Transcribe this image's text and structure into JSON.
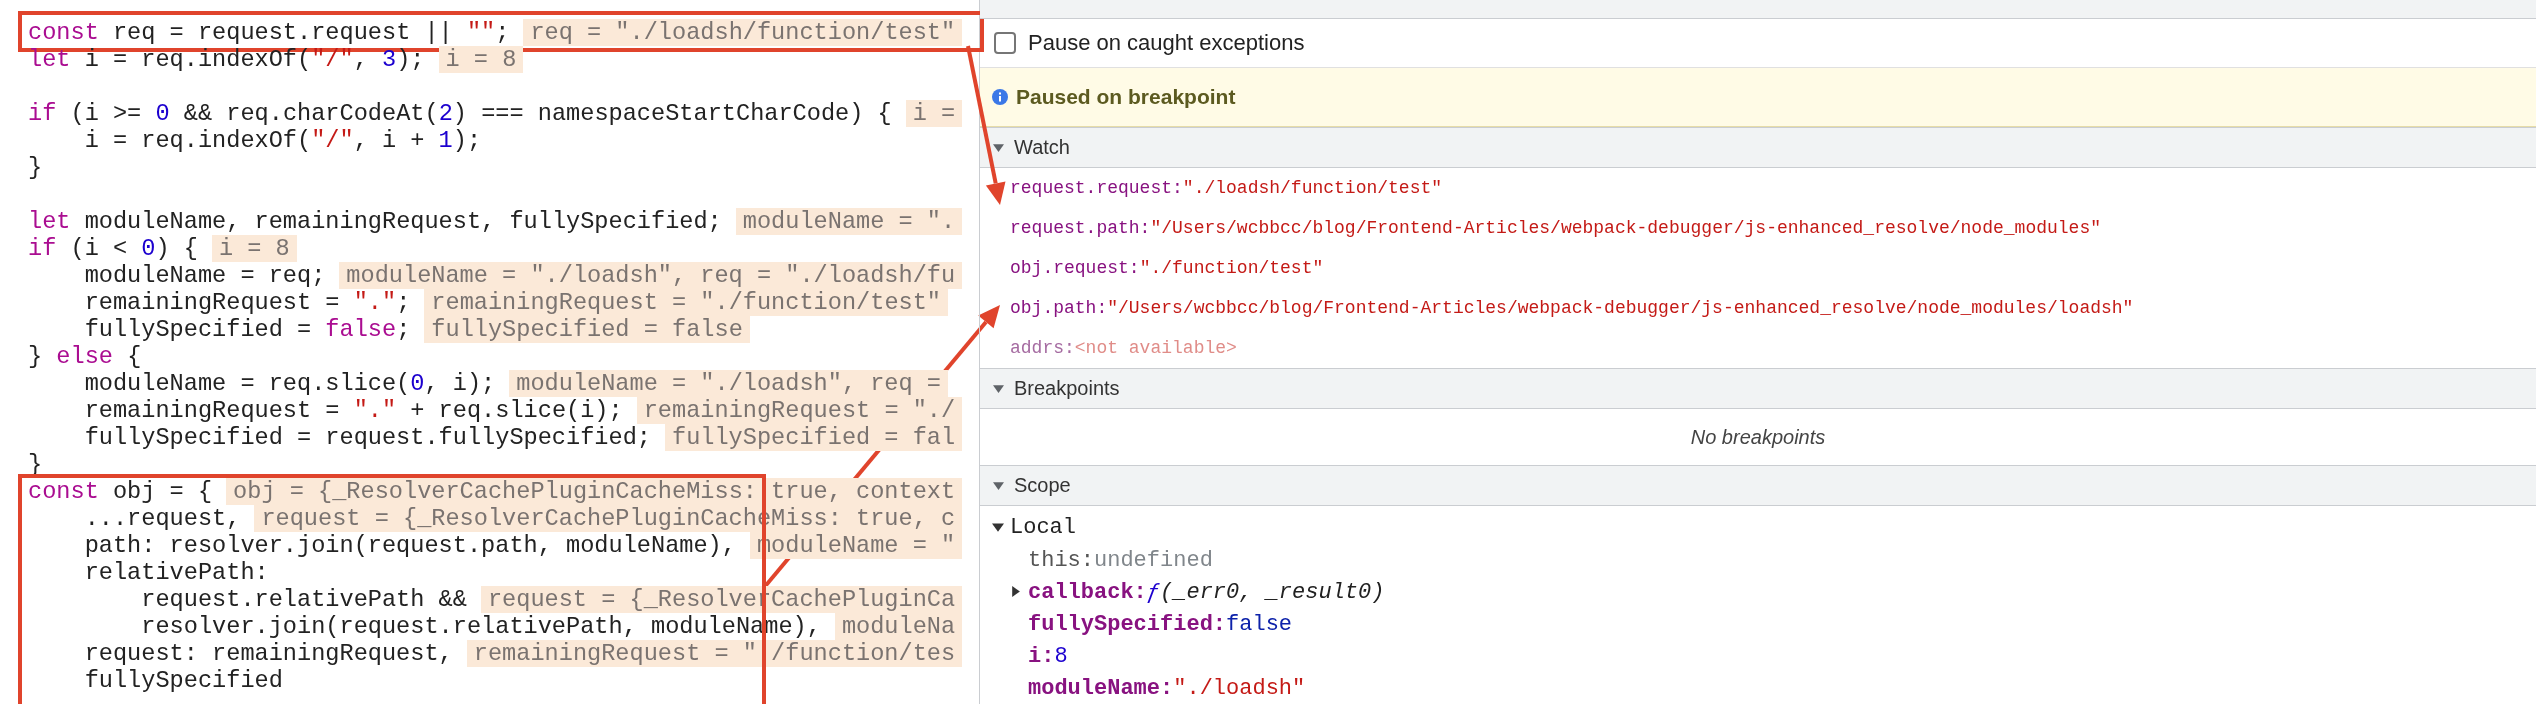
{
  "editor": {
    "blocks": [
      {
        "boxed": true,
        "lines": [
          {
            "tokens": [
              {
                "kind": "kw",
                "text": "const"
              },
              {
                "kind": "plain",
                "text": " req = request.request || "
              },
              {
                "kind": "str",
                "text": "\"\""
              },
              {
                "kind": "plain",
                "text": ";"
              }
            ],
            "inline": "req = \"./loadsh/function/test\""
          }
        ]
      },
      {
        "boxed": false,
        "lines": [
          {
            "tokens": [
              {
                "kind": "kw",
                "text": "let"
              },
              {
                "kind": "plain",
                "text": " i = req.indexOf("
              },
              {
                "kind": "str",
                "text": "\"/\""
              },
              {
                "kind": "plain",
                "text": ", "
              },
              {
                "kind": "num",
                "text": "3"
              },
              {
                "kind": "plain",
                "text": ");"
              }
            ],
            "inline": "i = 8"
          },
          {
            "blank_before": true,
            "tokens": [
              {
                "kind": "kw",
                "text": "if"
              },
              {
                "kind": "plain",
                "text": " (i >= "
              },
              {
                "kind": "num",
                "text": "0"
              },
              {
                "kind": "plain",
                "text": " && req.charCodeAt("
              },
              {
                "kind": "num",
                "text": "2"
              },
              {
                "kind": "plain",
                "text": ") === namespaceStartCharCode) {"
              }
            ],
            "inline": "i ="
          },
          {
            "tokens": [
              {
                "kind": "plain",
                "text": "    i = req.indexOf("
              },
              {
                "kind": "str",
                "text": "\"/\""
              },
              {
                "kind": "plain",
                "text": ", i + "
              },
              {
                "kind": "num",
                "text": "1"
              },
              {
                "kind": "plain",
                "text": ");"
              }
            ]
          },
          {
            "tokens": [
              {
                "kind": "plain",
                "text": "}"
              }
            ]
          },
          {
            "blank_before": true,
            "tokens": [
              {
                "kind": "kw",
                "text": "let"
              },
              {
                "kind": "plain",
                "text": " moduleName, remainingRequest, fullySpecified;"
              }
            ],
            "inline": "moduleName = \"."
          },
          {
            "tokens": [
              {
                "kind": "kw",
                "text": "if"
              },
              {
                "kind": "plain",
                "text": " (i < "
              },
              {
                "kind": "num",
                "text": "0"
              },
              {
                "kind": "plain",
                "text": ") {"
              }
            ],
            "inline": "i = 8"
          },
          {
            "tokens": [
              {
                "kind": "plain",
                "text": "    moduleName = req;"
              }
            ],
            "inline": "moduleName = \"./loadsh\", req = \"./loadsh/fu"
          },
          {
            "tokens": [
              {
                "kind": "plain",
                "text": "    remainingRequest = "
              },
              {
                "kind": "str",
                "text": "\".\""
              },
              {
                "kind": "plain",
                "text": ";"
              }
            ],
            "inline": "remainingRequest = \"./function/test\""
          },
          {
            "tokens": [
              {
                "kind": "plain",
                "text": "    fullySpecified = "
              },
              {
                "kind": "kw",
                "text": "false"
              },
              {
                "kind": "plain",
                "text": ";"
              }
            ],
            "inline": "fullySpecified = false"
          },
          {
            "tokens": [
              {
                "kind": "plain",
                "text": "} "
              },
              {
                "kind": "kw",
                "text": "else"
              },
              {
                "kind": "plain",
                "text": " {"
              }
            ]
          },
          {
            "tokens": [
              {
                "kind": "plain",
                "text": "    moduleName = req.slice("
              },
              {
                "kind": "num",
                "text": "0"
              },
              {
                "kind": "plain",
                "text": ", i);"
              }
            ],
            "inline": "moduleName = \"./loadsh\", req ="
          },
          {
            "tokens": [
              {
                "kind": "plain",
                "text": "    remainingRequest = "
              },
              {
                "kind": "str",
                "text": "\".\""
              },
              {
                "kind": "plain",
                "text": " + req.slice(i);"
              }
            ],
            "inline": "remainingRequest = \"./"
          },
          {
            "tokens": [
              {
                "kind": "plain",
                "text": "    fullySpecified = request.fullySpecified;"
              }
            ],
            "inline": "fullySpecified = fal"
          },
          {
            "tokens": [
              {
                "kind": "plain",
                "text": "}"
              }
            ]
          }
        ]
      },
      {
        "boxed": true,
        "lines": [
          {
            "tokens": [
              {
                "kind": "kw",
                "text": "const"
              },
              {
                "kind": "plain",
                "text": " obj = {"
              }
            ],
            "inline": "obj = {_ResolverCachePluginCacheMiss: true, context"
          },
          {
            "tokens": [
              {
                "kind": "plain",
                "text": "    ...request,"
              }
            ],
            "inline": "request = {_ResolverCachePluginCacheMiss: true, c"
          },
          {
            "tokens": [
              {
                "kind": "plain",
                "text": "    path: resolver.join(request.path, moduleName),"
              }
            ],
            "inline": "moduleName = \""
          },
          {
            "tokens": [
              {
                "kind": "plain",
                "text": "    relativePath:"
              }
            ]
          },
          {
            "tokens": [
              {
                "kind": "plain",
                "text": "        request.relativePath &&"
              }
            ],
            "inline": "request = {_ResolverCachePluginCa"
          },
          {
            "tokens": [
              {
                "kind": "plain",
                "text": "        resolver.join(request.relativePath, moduleName),"
              }
            ],
            "inline": "moduleNa"
          },
          {
            "tokens": [
              {
                "kind": "plain",
                "text": "    request: remainingRequest,"
              }
            ],
            "inline": "remainingRequest = \"./function/tes"
          },
          {
            "tokens": [
              {
                "kind": "plain",
                "text": "    fullySpecified"
              }
            ]
          }
        ]
      }
    ]
  },
  "debugger": {
    "pause_on_caught": {
      "label": "Pause on caught exceptions",
      "checked": false
    },
    "banner": "Paused on breakpoint",
    "watch": {
      "title": "Watch",
      "expanded": true,
      "items": [
        {
          "kind": "value",
          "name": "request.request:",
          "value": "\"./loadsh/function/test\""
        },
        {
          "kind": "value",
          "name": "request.path:",
          "value": "\"/Users/wcbbcc/blog/Frontend-Articles/webpack-debugger/js-enhanced_resolve/node_modules\""
        },
        {
          "kind": "value",
          "name": "obj.request:",
          "value": "\"./function/test\""
        },
        {
          "kind": "value",
          "name": "obj.path:",
          "value": "\"/Users/wcbbcc/blog/Frontend-Articles/webpack-debugger/js-enhanced_resolve/node_modules/loadsh\""
        },
        {
          "kind": "unavailable",
          "name": "addrs:",
          "value": "<not available>"
        }
      ]
    },
    "breakpoints": {
      "title": "Breakpoints",
      "expanded": true,
      "empty_text": "No breakpoints"
    },
    "scope": {
      "title": "Scope",
      "expanded": true,
      "local": {
        "title": "Local",
        "expanded": true,
        "items": [
          {
            "name": "this:",
            "kind": "undefined",
            "value": "undefined",
            "own": false
          },
          {
            "name": "callback:",
            "kind": "function",
            "value": "(_err0, _result0)",
            "prefix": "ƒ",
            "own": true,
            "expanded": false
          },
          {
            "name": "fullySpecified:",
            "kind": "boolean",
            "value": "false",
            "own": true
          },
          {
            "name": "i:",
            "kind": "number",
            "value": "8",
            "own": true
          },
          {
            "name": "moduleName:",
            "kind": "string",
            "value": "\"./loadsh\"",
            "own": true
          }
        ]
      }
    }
  }
}
